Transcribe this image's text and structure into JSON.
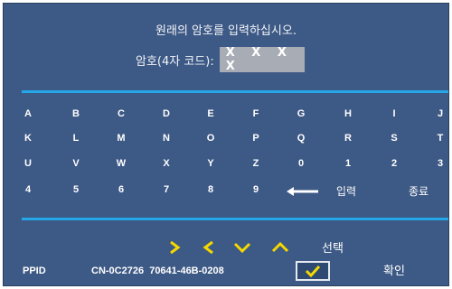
{
  "prompt": "원래의 암호를 입력하십시오.",
  "password": {
    "label": "암호(4자 코드):",
    "value": "X X X X"
  },
  "keypad": {
    "rows": [
      [
        "A",
        "B",
        "C",
        "D",
        "E",
        "F",
        "G",
        "H",
        "I",
        "J"
      ],
      [
        "K",
        "L",
        "M",
        "N",
        "O",
        "P",
        "Q",
        "R",
        "S",
        "T"
      ],
      [
        "U",
        "V",
        "W",
        "X",
        "Y",
        "Z",
        "0",
        "1",
        "2",
        "3"
      ],
      [
        "4",
        "5",
        "6",
        "7",
        "8",
        "9"
      ]
    ],
    "enter_label": "입력",
    "exit_label": "종료",
    "backspace_icon": "left-arrow-icon"
  },
  "navigation": {
    "icons": [
      "right-chevron-icon",
      "left-chevron-icon",
      "down-chevron-icon",
      "up-chevron-icon"
    ],
    "select_label": "선택",
    "arrow_color": "#f5d800"
  },
  "footer": {
    "ppid_label": "PPID",
    "ppid_value": "CN-0C2726  70641-46B-0208",
    "confirm_icon": "checkmark-icon",
    "confirm_label": "확인"
  },
  "colors": {
    "background": "#3d5985",
    "divider": "#25a7e8",
    "password_box": "#a8adb5"
  }
}
